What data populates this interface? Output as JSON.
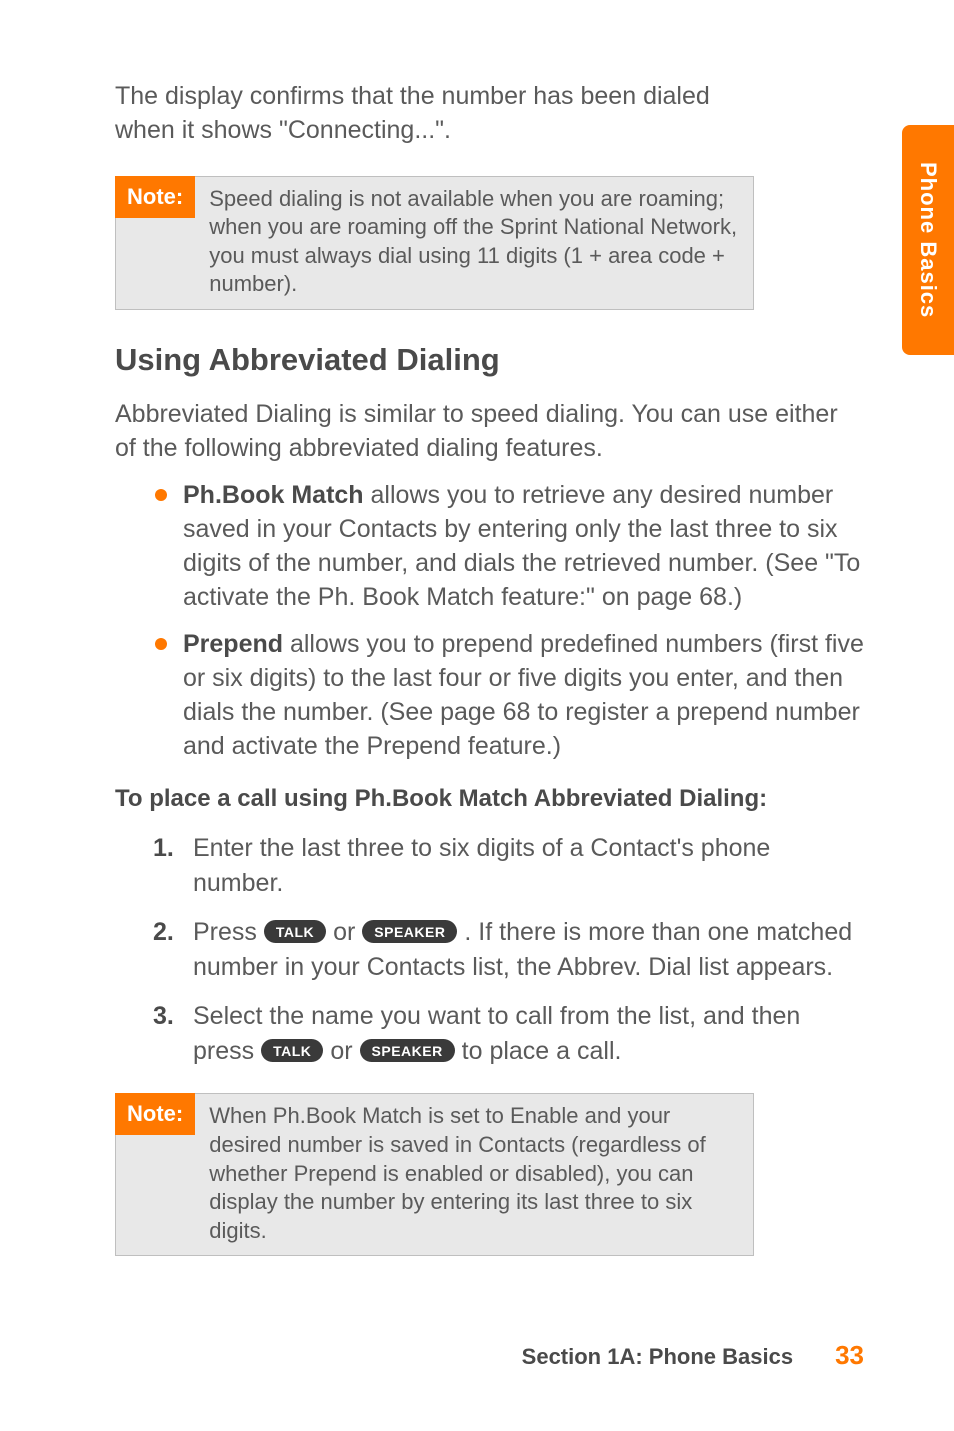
{
  "side_tab": "Phone Basics",
  "intro": "The display confirms that the number has been dialed when it shows \"Connecting...\".",
  "note1": {
    "label": "Note:",
    "text": "Speed dialing is not available when you are roaming; when you are roaming off the Sprint National Network, you must always dial using 11 digits (1 + area code + number)."
  },
  "heading": "Using Abbreviated Dialing",
  "para1": "Abbreviated Dialing is similar to speed dialing. You can use either of the following abbreviated dialing features.",
  "bullets": [
    {
      "bold": "Ph.Book Match",
      "rest": " allows you to retrieve any desired number saved in your Contacts by entering only the last three to six digits of the number, and dials the retrieved number. (See \"To activate the Ph. Book Match feature:\" on page 68.)"
    },
    {
      "bold": "Prepend",
      "rest": " allows you to prepend predefined numbers (first five or six digits) to the last four or five digits you enter, and then dials the number. (See page 68 to register a prepend number and activate the Prepend feature.)"
    }
  ],
  "subheading": "To place a call using Ph.Book Match Abbreviated Dialing:",
  "steps": {
    "s1": "Enter the last three to six digits of a Contact's phone number.",
    "s2_pre": "Press ",
    "s2_or": " or ",
    "s2_post": " . If there is more than one matched number in your Contacts list, the Abbrev. Dial list appears.",
    "s3_pre": "Select the name you want to call from the list, and then press ",
    "s3_or": " or ",
    "s3_post": " to place a call."
  },
  "keys": {
    "talk": "TALK",
    "speaker": "SPEAKER"
  },
  "note2": {
    "label": "Note:",
    "text": "When Ph.Book Match is set to Enable and your desired number is saved in Contacts (regardless of whether Prepend is enabled or disabled), you can display the number by entering its last three to six digits."
  },
  "footer": {
    "section": "Section 1A: Phone Basics",
    "page": "33"
  }
}
